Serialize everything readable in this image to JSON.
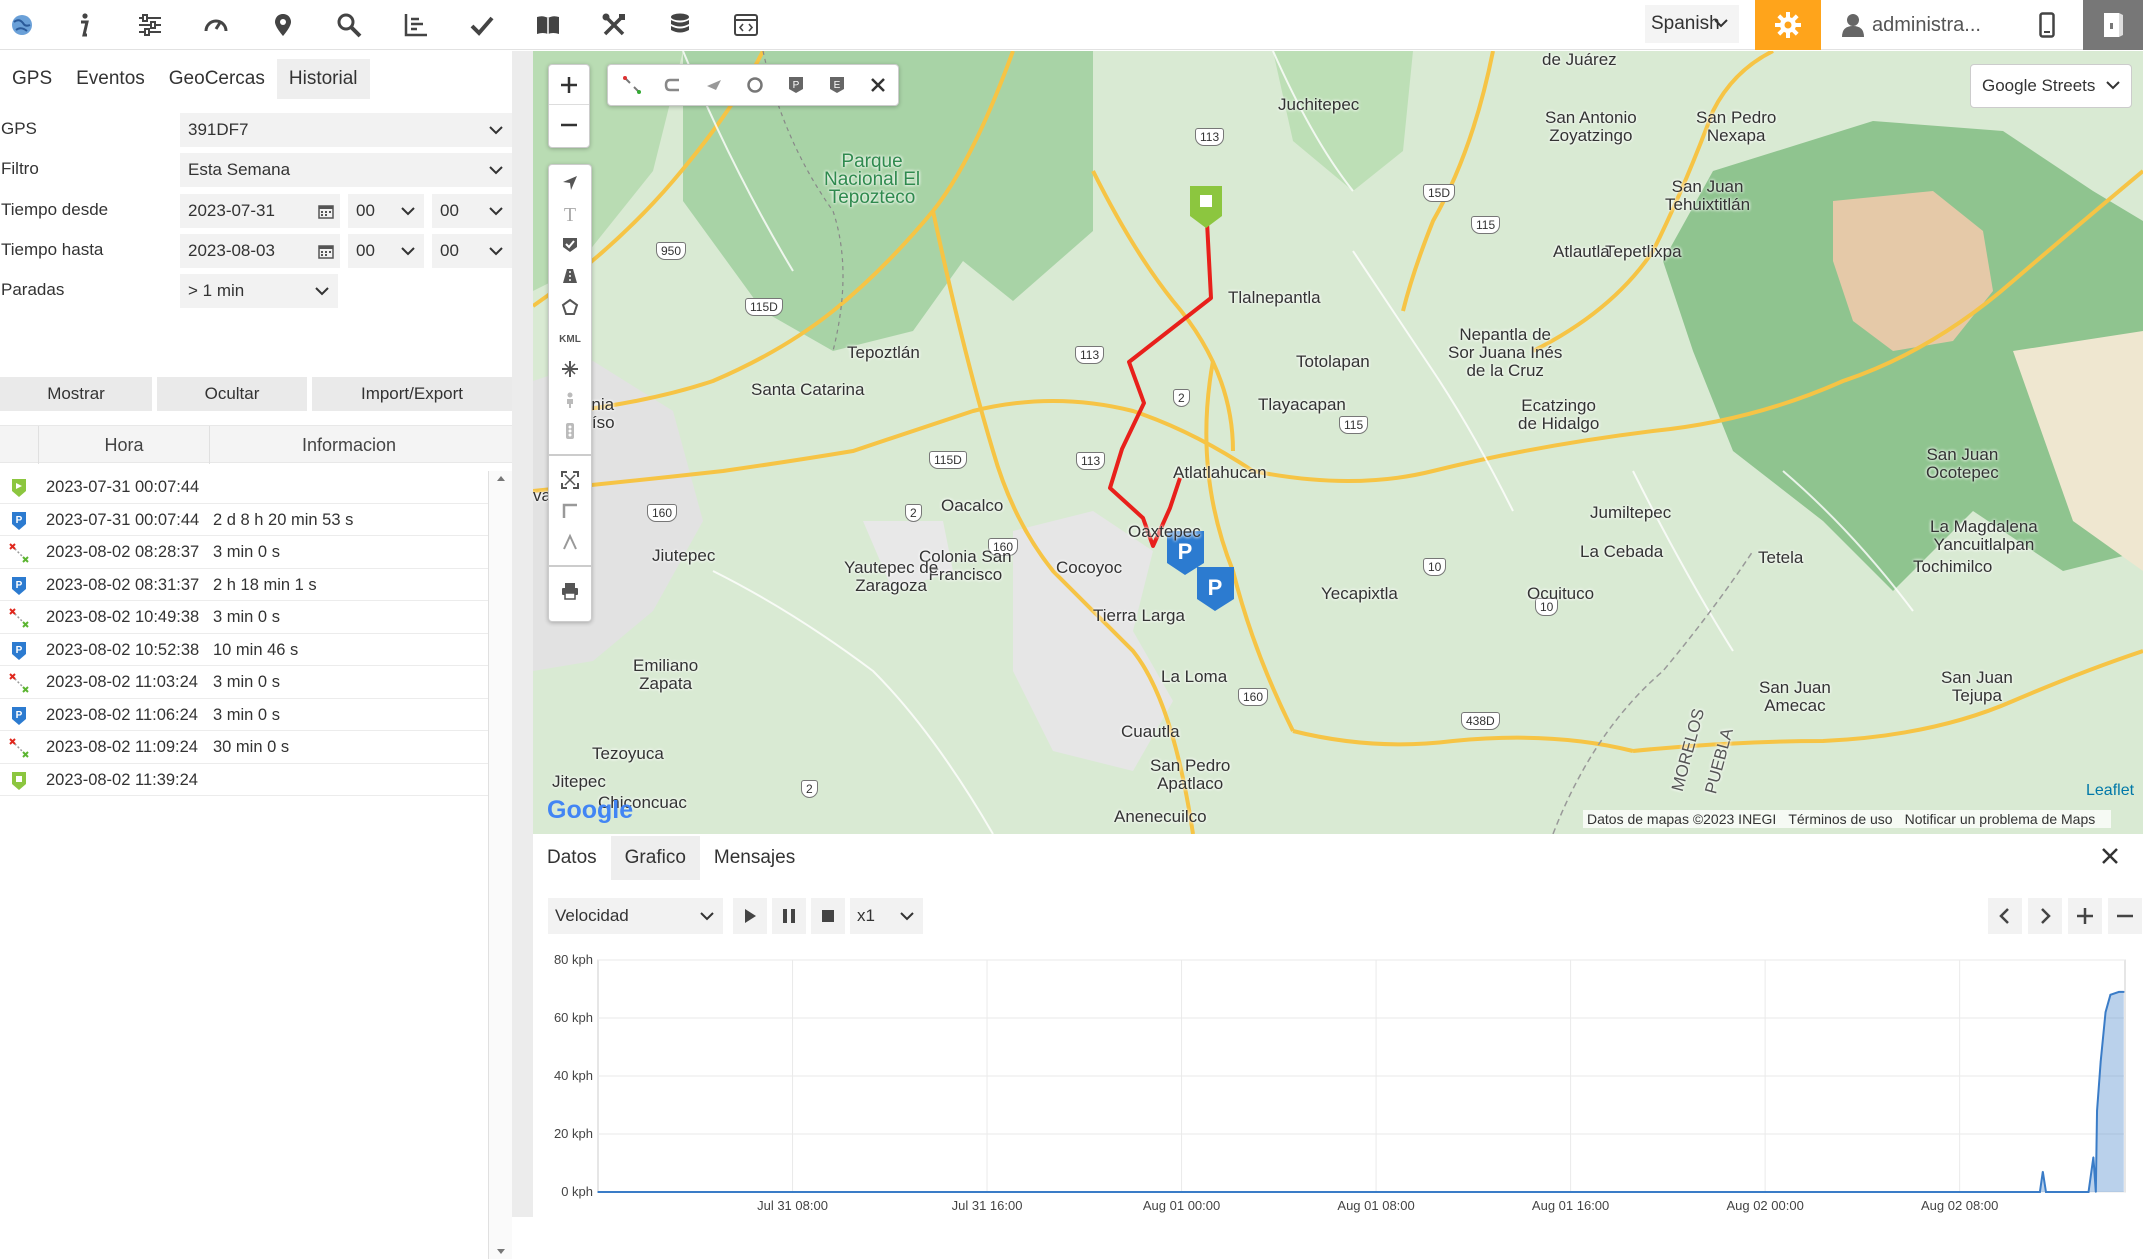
{
  "topbar": {
    "icons": [
      "globe-icon",
      "info-icon",
      "sliders-icon",
      "gauge-icon",
      "map-pin-icon",
      "search-icon",
      "chart-icon",
      "check-icon",
      "book-icon",
      "tools-icon",
      "coins-icon",
      "code-icon"
    ],
    "language": "Spanish",
    "user": "administra...",
    "accent": "#ffa41b"
  },
  "left": {
    "tabs": [
      "GPS",
      "Eventos",
      "GeoCercas",
      "Historial"
    ],
    "active_tab": "Historial",
    "form": {
      "gps_label": "GPS",
      "gps_value": "391DF7",
      "filter_label": "Filtro",
      "filter_value": "Esta Semana",
      "from_label": "Tiempo desde",
      "from_date": "2023-07-31",
      "from_h": "00",
      "from_m": "00",
      "to_label": "Tiempo hasta",
      "to_date": "2023-08-03",
      "to_h": "00",
      "to_m": "00",
      "stops_label": "Paradas",
      "stops_value": "> 1 min"
    },
    "buttons": {
      "show": "Mostrar",
      "hide": "Ocultar",
      "import": "Import/Export"
    },
    "table": {
      "col_time": "Hora",
      "col_info": "Informacion",
      "rows": [
        {
          "type": "start",
          "time": "2023-07-31 00:07:44",
          "info": ""
        },
        {
          "type": "parking",
          "time": "2023-07-31 00:07:44",
          "info": "2 d 8 h 20 min 53 s"
        },
        {
          "type": "drive",
          "time": "2023-08-02 08:28:37",
          "info": "3 min 0 s"
        },
        {
          "type": "parking",
          "time": "2023-08-02 08:31:37",
          "info": "2 h 18 min 1 s"
        },
        {
          "type": "drive",
          "time": "2023-08-02 10:49:38",
          "info": "3 min 0 s"
        },
        {
          "type": "parking",
          "time": "2023-08-02 10:52:38",
          "info": "10 min 46 s"
        },
        {
          "type": "drive",
          "time": "2023-08-02 11:03:24",
          "info": "3 min 0 s"
        },
        {
          "type": "parking",
          "time": "2023-08-02 11:06:24",
          "info": "3 min 0 s"
        },
        {
          "type": "drive",
          "time": "2023-08-02 11:09:24",
          "info": "30 min 0 s"
        },
        {
          "type": "end",
          "time": "2023-08-02 11:39:24",
          "info": ""
        }
      ]
    }
  },
  "map": {
    "layer": "Google Streets",
    "attribution": [
      "Datos de mapas ©2023 INEGI",
      "Términos de uso",
      "Notificar un problema de Maps"
    ],
    "leaflet": "Leaflet",
    "google": "Google",
    "draw_tools": [
      "select-area-icon",
      "polyline-icon",
      "arrow-icon",
      "circle-icon",
      "parking-marker-icon",
      "event-marker-icon",
      "close-icon"
    ],
    "side_tools": [
      "navigate-icon",
      "text-icon",
      "shield-icon",
      "road-icon",
      "polygon-icon",
      "kml-icon",
      "pan-cross-icon",
      "person-icon",
      "traffic-icon",
      "fullscreen-icon",
      "ruler-icon",
      "angle-icon",
      "print-icon"
    ],
    "route_color": "#e8201b",
    "labels": [
      {
        "t": "Juchitepec",
        "park": false
      },
      {
        "t": "San Antonio\nZoyatzingo",
        "park": false
      },
      {
        "t": "San Pedro\nNexapa",
        "park": false
      },
      {
        "t": "Parque\nNacional El\nTepozteco",
        "park": true
      },
      {
        "t": "San Juan\nTehuixtitlán",
        "park": false
      },
      {
        "t": "Tepetlixpa",
        "park": false
      },
      {
        "t": "Atlautla",
        "park": false
      },
      {
        "t": "Tlalnepantla",
        "park": false
      },
      {
        "t": "Nepantla de\nSor Juana Inés\nde la Cruz",
        "park": false
      },
      {
        "t": "Tepoztlán",
        "park": false
      },
      {
        "t": "Totolapan",
        "park": false
      },
      {
        "t": "Santa Catarina",
        "park": false
      },
      {
        "t": "Tlayacapan",
        "park": false
      },
      {
        "t": "Colonia\nParaíso",
        "park": false
      },
      {
        "t": "Ecatzingo\nde Hidalgo",
        "park": false
      },
      {
        "t": "San Juan\nOcotepec",
        "park": false
      },
      {
        "t": "Atlatlahucan",
        "park": false
      },
      {
        "t": "Oacalco",
        "park": false
      },
      {
        "t": "Jumiltepec",
        "park": false
      },
      {
        "t": "La Magdalena\nYancuitlalpan",
        "park": false
      },
      {
        "t": "Oaxtepec",
        "park": false
      },
      {
        "t": "Jiutepec",
        "park": false
      },
      {
        "t": "Colonia San\nFrancisco",
        "park": false
      },
      {
        "t": "La Cebada",
        "park": false
      },
      {
        "t": "Tetela",
        "park": false
      },
      {
        "t": "Tochimilco",
        "park": false
      },
      {
        "t": "Yautepec de\nZaragoza",
        "park": false
      },
      {
        "t": "Cocoyoc",
        "park": false
      },
      {
        "t": "Yecapixtla",
        "park": false
      },
      {
        "t": "Ocuituco",
        "park": false
      },
      {
        "t": "Tierra Larga",
        "park": false
      },
      {
        "t": "Emiliano\nZapata",
        "park": false
      },
      {
        "t": "La Loma",
        "park": false
      },
      {
        "t": "San Juan\nTejupa",
        "park": false
      },
      {
        "t": "San Juan\nAmecac",
        "park": false
      },
      {
        "t": "Cuautla",
        "park": false
      },
      {
        "t": "Tezoyuca",
        "park": false
      },
      {
        "t": "San Pedro\nApatlaco",
        "park": false
      },
      {
        "t": "Jitepec",
        "park": false
      },
      {
        "t": "Chiconcuac",
        "park": false
      },
      {
        "t": "vaca",
        "park": false
      },
      {
        "t": "Anenecuilco",
        "park": false
      },
      {
        "t": "de Juárez",
        "park": false
      },
      {
        "t": "MORELOS",
        "park": false
      },
      {
        "t": "PUEBLA",
        "park": false
      }
    ],
    "shields": [
      "113",
      "15D",
      "115",
      "950",
      "115D",
      "113",
      "2",
      "115D",
      "113",
      "115",
      "2",
      "160",
      "160",
      "10",
      "10",
      "160",
      "438D",
      "2"
    ]
  },
  "bottom": {
    "tabs": [
      "Datos",
      "Grafico",
      "Mensajes"
    ],
    "active_tab": "Grafico",
    "metric": "Velocidad",
    "speed_factor": "x1"
  },
  "chart_data": {
    "type": "area",
    "title": "",
    "ylabel": "",
    "yticks": [
      "0 kph",
      "20 kph",
      "40 kph",
      "60 kph",
      "80 kph"
    ],
    "ylim": [
      0,
      80
    ],
    "xticks": [
      "Jul 31 08:00",
      "Jul 31 16:00",
      "Aug 01 00:00",
      "Aug 01 08:00",
      "Aug 01 16:00",
      "Aug 02 00:00",
      "Aug 02 08:00"
    ],
    "x_hours": [
      0,
      8,
      16,
      24,
      32,
      40,
      48,
      56,
      59.3,
      59.42,
      59.55,
      59.6,
      61.3,
      61.5,
      61.6,
      61.65,
      61.8,
      62.0,
      62.2,
      62.55,
      62.75
    ],
    "x_origin": "Jul 31 00:00",
    "x_range_hours": [
      0,
      62.8
    ],
    "values": [
      0,
      0,
      0,
      0,
      0,
      0,
      0,
      0,
      0,
      7,
      0,
      0,
      0,
      12,
      0,
      28,
      45,
      62,
      68,
      69,
      69
    ],
    "grid": true,
    "color": "#3a7cc7"
  }
}
